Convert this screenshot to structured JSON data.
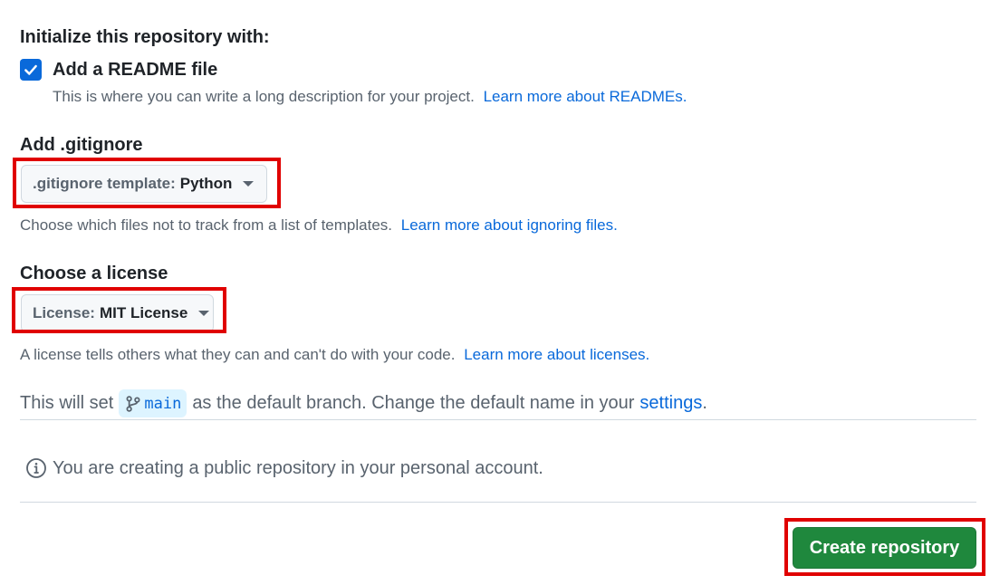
{
  "init": {
    "heading": "Initialize this repository with:",
    "readme": {
      "checked": true,
      "label": "Add a README file",
      "description": "This is where you can write a long description for your project.",
      "link": "Learn more about READMEs."
    }
  },
  "gitignore": {
    "heading": "Add .gitignore",
    "select_prefix": ".gitignore template:",
    "select_value": "Python",
    "description": "Choose which files not to track from a list of templates.",
    "link": "Learn more about ignoring files."
  },
  "license": {
    "heading": "Choose a license",
    "select_prefix": "License:",
    "select_value": "MIT License",
    "description": "A license tells others what they can and can't do with your code.",
    "link": "Learn more about licenses."
  },
  "branch": {
    "prefix": "This will set",
    "name": "main",
    "middle": "as the default branch. Change the default name in your",
    "link": "settings",
    "suffix": "."
  },
  "notice": {
    "icon": "info-icon",
    "text": "You are creating a public repository in your personal account."
  },
  "actions": {
    "create_label": "Create repository"
  },
  "colors": {
    "primary_button": "#1f883d",
    "link": "#0969da",
    "highlight": "#e00000",
    "checkbox": "#0969da"
  }
}
